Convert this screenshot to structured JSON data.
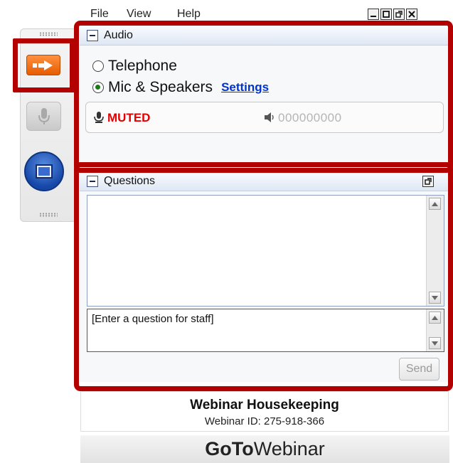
{
  "menu": {
    "file": "File",
    "view": "View",
    "help": "Help"
  },
  "window_controls": [
    "minimize-icon",
    "maximize-icon",
    "restore-icon",
    "close-icon"
  ],
  "audio": {
    "title": "Audio",
    "options": [
      {
        "label": "Telephone",
        "selected": false
      },
      {
        "label": "Mic & Speakers",
        "selected": true
      }
    ],
    "settings_link": "Settings",
    "mute_status": "MUTED",
    "level_meter": "000000000"
  },
  "questions": {
    "title": "Questions",
    "entry_placeholder": "[Enter a question for staff]",
    "send_label": "Send"
  },
  "footer": {
    "title": "Webinar Housekeeping",
    "id_line": "Webinar ID: 275-918-366"
  },
  "brand": {
    "goto": "GoTo",
    "webinar": "Webinar"
  },
  "colors": {
    "highlight": "#b30000",
    "muted": "#e40000",
    "accent": "#e65c00",
    "link": "#0033cc"
  }
}
